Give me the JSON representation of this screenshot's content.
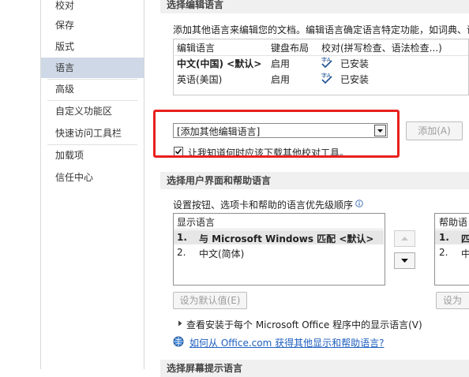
{
  "nav": {
    "items": [
      {
        "label": "校对"
      },
      {
        "label": "保存"
      },
      {
        "label": "版式"
      },
      {
        "label": "语言"
      },
      {
        "label": "高级"
      },
      {
        "label": "自定义功能区"
      },
      {
        "label": "快速访问工具栏"
      },
      {
        "label": "加载项"
      },
      {
        "label": "信任中心"
      }
    ],
    "active": "语言"
  },
  "editing": {
    "header": "选择编辑语言",
    "description": "添加其他语言来编辑您的文档。编辑语言确定语言特定功能，如词典、语法",
    "columns": [
      "编辑语言",
      "键盘布局",
      "校对(拼写检查、语法检查...)"
    ],
    "rows": [
      {
        "language": "中文(中国) <默认>",
        "keyboard": "启用",
        "proofing": "已安装"
      },
      {
        "language": "英语(美国)",
        "keyboard": "启用",
        "proofing": "已安装"
      }
    ],
    "add_dropdown_value": "[添加其他编辑语言]",
    "add_button": "添加(A)",
    "checkbox_label": "让我知道何时应该下载其他校对工具。",
    "checkbox_checked": true
  },
  "ui_help": {
    "header": "选择用户界面和帮助语言",
    "description": "设置按钮、选项卡和帮助的语言优先级顺序",
    "display_list": {
      "header": "显示语言",
      "items": [
        {
          "num": "1.",
          "label": "与 Microsoft Windows 匹配 <默认>"
        },
        {
          "num": "2.",
          "label": "中文(简体)"
        }
      ]
    },
    "help_list": {
      "header": "帮助语",
      "items": [
        {
          "num": "1.",
          "label": "四"
        },
        {
          "num": "2.",
          "label": "中"
        }
      ]
    },
    "set_default_button": "设为默认值(E)",
    "set_default_button_right": "设为",
    "view_installed": "查看安装于每个 Microsoft Office 程序中的显示语言(V)",
    "link": "如何从 Office.com 获得其他显示和帮助语言?"
  },
  "screen_tip": {
    "header": "选择屏幕提示语言"
  },
  "colors": {
    "active_nav": "#cfd8e6",
    "highlight_red": "#e8201d",
    "link_blue": "#1f5fbf"
  }
}
